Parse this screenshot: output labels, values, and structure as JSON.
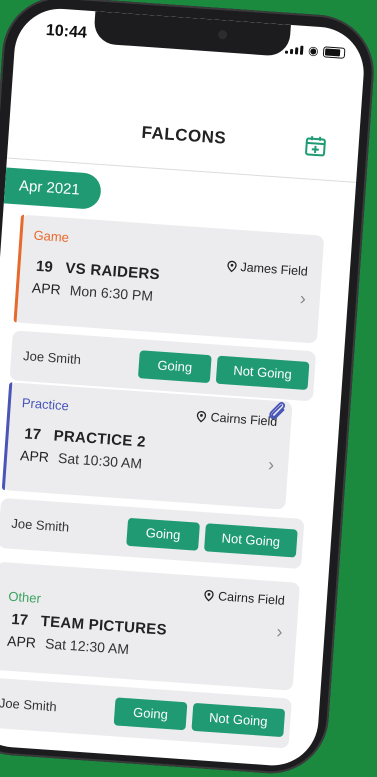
{
  "status": {
    "time": "10:44"
  },
  "header": {
    "title": "FALCONS",
    "add_icon": "calendar-plus-icon"
  },
  "month_pill": {
    "label": "Apr 2021"
  },
  "colors": {
    "accent": "#1f9a73",
    "game": "#e8692c",
    "practice": "#4a55b8",
    "other": "#3aa35e"
  },
  "events": [
    {
      "type": "Game",
      "location": "James Field",
      "day": "19",
      "month": "APR",
      "title": "VS RAIDERS",
      "time": "Mon 6:30 PM",
      "rsvp": {
        "name": "Joe Smith",
        "going": "Going",
        "not_going": "Not Going"
      }
    },
    {
      "type": "Practice",
      "location": "Cairns Field",
      "day": "17",
      "month": "APR",
      "title": "PRACTICE 2",
      "time": "Sat 10:30 AM",
      "rsvp": {
        "name": "Joe Smith",
        "going": "Going",
        "not_going": "Not Going"
      }
    },
    {
      "type": "Other",
      "location": "Cairns Field",
      "day": "17",
      "month": "APR",
      "title": "TEAM PICTURES",
      "time": "Sat 12:30 AM",
      "rsvp": {
        "name": "Joe Smith",
        "going": "Going",
        "not_going": "Not Going"
      }
    }
  ]
}
